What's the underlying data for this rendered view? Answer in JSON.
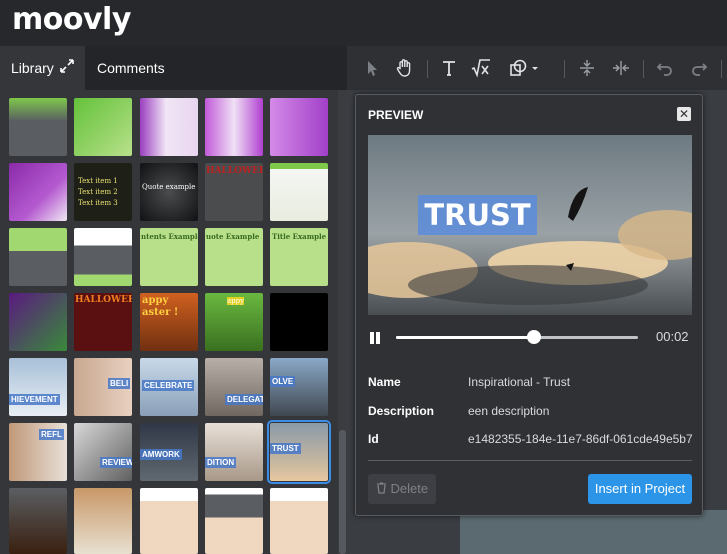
{
  "app": {
    "logo": "moovly"
  },
  "tabs": {
    "library": "Library",
    "comments": "Comments"
  },
  "preview": {
    "title": "PREVIEW",
    "overlay_text": "TRUST",
    "time": "00:02",
    "progress": 0.57,
    "fields": {
      "name_label": "Name",
      "name_value": "Inspirational - Trust",
      "description_label": "Description",
      "description_value": "een description",
      "id_label": "Id",
      "id_value": "e1482355-184e-11e7-86df-061cde49e5b7"
    },
    "delete_label": "Delete",
    "insert_label": "Insert in Project"
  },
  "thumb_labels": {
    "quote": "Quote example",
    "text1": "Text item 1",
    "text2": "Text item 2",
    "text3": "Text item 3",
    "contents": "ntents Example",
    "quote2": "uote Example",
    "title": "Title Example",
    "halloween": "HALLOWEEN",
    "happy": "appy",
    "easter": "aster !",
    "believe": "BELI",
    "celebrate": "CELEBRATE",
    "delegate": "DELEGAT",
    "achievement": "HIEVEMENT",
    "solve": "OLVE",
    "reflect": "REFL",
    "review": "REVIEW",
    "teamwork": "AMWORK",
    "edition": "DITION",
    "trust": "TRUST"
  },
  "colors": {
    "accent": "#2d95e8",
    "selected": "#3b8de8"
  }
}
